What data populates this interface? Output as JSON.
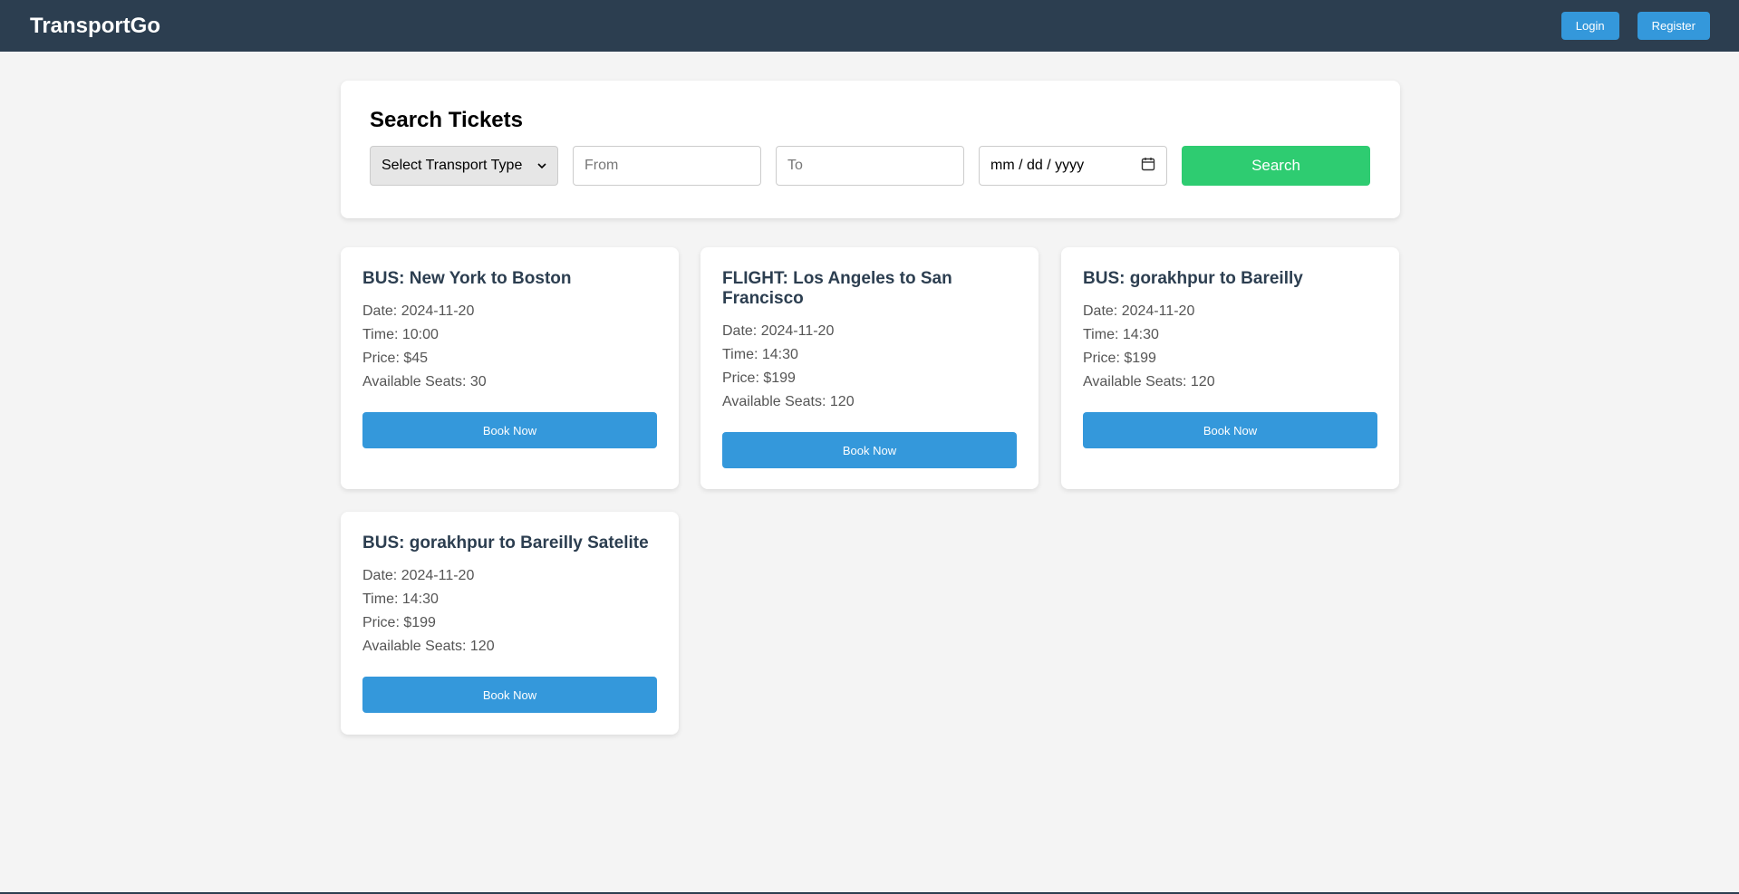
{
  "header": {
    "brand": "TransportGo",
    "login_label": "Login",
    "register_label": "Register"
  },
  "search": {
    "title": "Search Tickets",
    "transport_select": "Select Transport Type",
    "from_placeholder": "From",
    "to_placeholder": "To",
    "date_placeholder": "mm / dd / yyyy",
    "button_label": "Search"
  },
  "tickets": [
    {
      "title": "BUS: New York to Boston",
      "date": "Date: 2024-11-20",
      "time": "Time: 10:00",
      "price": "Price: $45",
      "seats": "Available Seats: 30",
      "button": "Book Now"
    },
    {
      "title": "FLIGHT: Los Angeles to San Francisco",
      "date": "Date: 2024-11-20",
      "time": "Time: 14:30",
      "price": "Price: $199",
      "seats": "Available Seats: 120",
      "button": "Book Now"
    },
    {
      "title": "BUS: gorakhpur to Bareilly",
      "date": "Date: 2024-11-20",
      "time": "Time: 14:30",
      "price": "Price: $199",
      "seats": "Available Seats: 120",
      "button": "Book Now"
    },
    {
      "title": "BUS: gorakhpur to Bareilly Satelite",
      "date": "Date: 2024-11-20",
      "time": "Time: 14:30",
      "price": "Price: $199",
      "seats": "Available Seats: 120",
      "button": "Book Now"
    }
  ],
  "colors": {
    "navbar": "#2c3e50",
    "primary": "#3498db",
    "search": "#2ecc71",
    "background": "#f4f4f4"
  },
  "icons": {
    "select_arrow": "chevron-down-icon",
    "date_picker": "calendar-icon"
  }
}
